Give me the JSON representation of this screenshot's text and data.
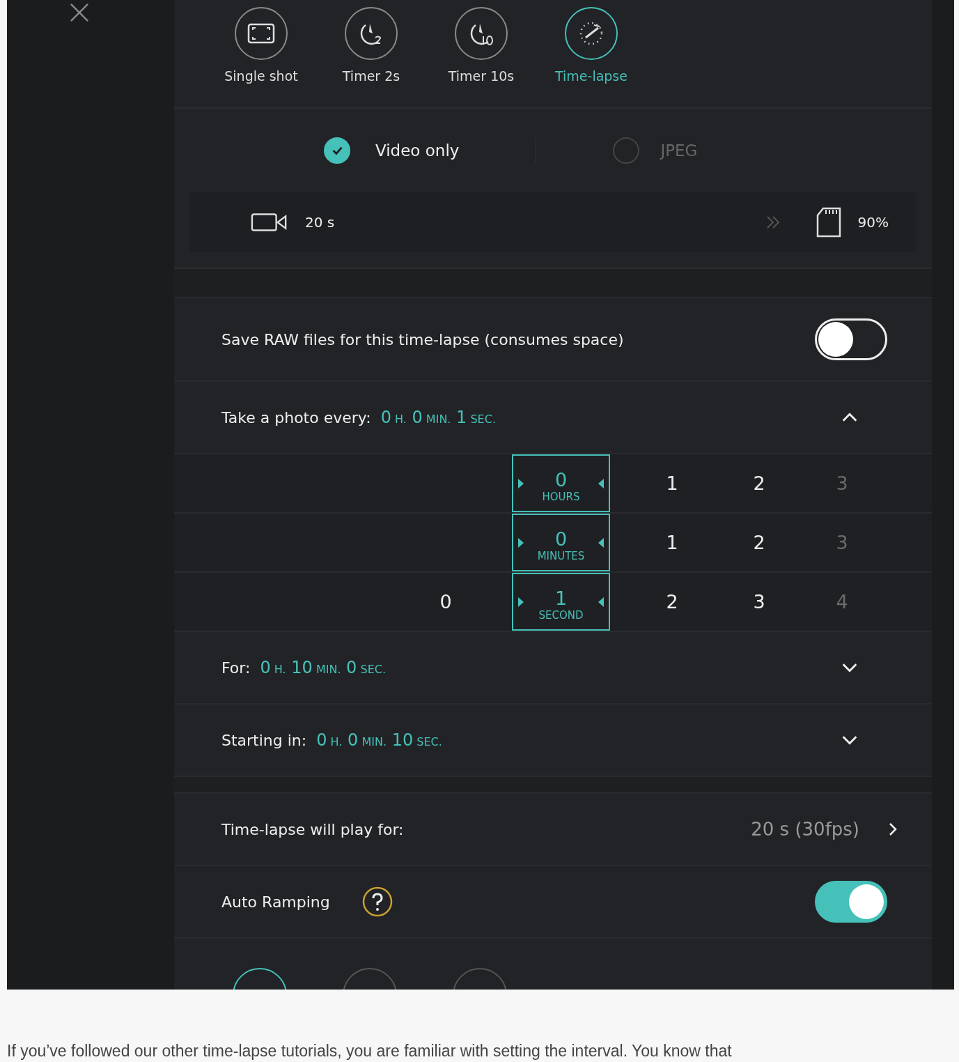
{
  "modes": [
    {
      "kind": "single",
      "label": "Single shot",
      "selected": false
    },
    {
      "kind": "timer2",
      "label": "Timer 2s",
      "selected": false
    },
    {
      "kind": "timer10",
      "label": "Timer 10s",
      "selected": false
    },
    {
      "kind": "timelapse",
      "label": "Time-lapse",
      "selected": true
    }
  ],
  "formats": [
    {
      "label": "Video only",
      "selected": true
    },
    {
      "label": "JPEG",
      "selected": false
    }
  ],
  "info": {
    "duration": "20 s",
    "storage": "90%"
  },
  "raw": {
    "label": "Save RAW files for this time-lapse (consumes space)",
    "on": false
  },
  "interval": {
    "label": "Take a photo every:",
    "expanded": true,
    "value": [
      {
        "num": "0",
        "unit": "H."
      },
      {
        "num": "0",
        "unit": "MIN."
      },
      {
        "num": "1",
        "unit": "SEC."
      }
    ]
  },
  "picker": [
    {
      "unit": "HOURS",
      "items": [
        {
          "text": "0",
          "selected": true,
          "faded": false
        },
        {
          "text": "1",
          "selected": false,
          "faded": false
        },
        {
          "text": "2",
          "selected": false,
          "faded": false
        },
        {
          "text": "3",
          "selected": false,
          "faded": true
        }
      ]
    },
    {
      "unit": "MINUTES",
      "items": [
        {
          "text": "0",
          "selected": true,
          "faded": false
        },
        {
          "text": "1",
          "selected": false,
          "faded": false
        },
        {
          "text": "2",
          "selected": false,
          "faded": false
        },
        {
          "text": "3",
          "selected": false,
          "faded": true
        }
      ]
    },
    {
      "unit": "SECOND",
      "items": [
        {
          "text": "0",
          "selected": false,
          "faded": false
        },
        {
          "text": "1",
          "selected": true,
          "faded": false
        },
        {
          "text": "2",
          "selected": false,
          "faded": false
        },
        {
          "text": "3",
          "selected": false,
          "faded": false
        },
        {
          "text": "4",
          "selected": false,
          "faded": true
        }
      ]
    }
  ],
  "durations": [
    {
      "label": "For:",
      "expanded": false,
      "value": [
        {
          "num": "0",
          "unit": "H."
        },
        {
          "num": "10",
          "unit": "MIN."
        },
        {
          "num": "0",
          "unit": "SEC."
        }
      ]
    },
    {
      "label": "Starting in:",
      "expanded": false,
      "value": [
        {
          "num": "0",
          "unit": "H."
        },
        {
          "num": "0",
          "unit": "MIN."
        },
        {
          "num": "10",
          "unit": "SEC."
        }
      ]
    }
  ],
  "playback": {
    "label": "Time-lapse will play for:",
    "value": "20 s (30fps)"
  },
  "ramping": {
    "label": "Auto Ramping",
    "on": true
  },
  "lower_modes": [
    {
      "selected": true
    },
    {
      "selected": false
    },
    {
      "selected": false
    }
  ],
  "caption": "If you’ve followed our other time-lapse tutorials, you are familiar with setting the interval. You know that"
}
